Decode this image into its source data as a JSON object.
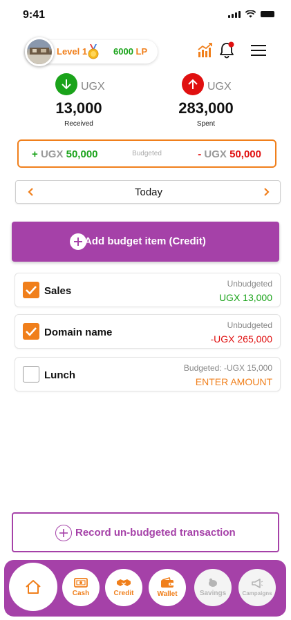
{
  "status_bar": {
    "time": "9:41"
  },
  "header": {
    "level": "Level 1",
    "points_value": "6000",
    "points_unit": "LP",
    "icons": [
      "avatar",
      "medal-icon",
      "chart-icon",
      "bell-icon",
      "menu-icon"
    ]
  },
  "summary": {
    "received": {
      "currency": "UGX",
      "amount": "13,000",
      "label": "Received",
      "color": "#1aa31a"
    },
    "spent": {
      "currency": "UGX",
      "amount": "283,000",
      "label": "Spent",
      "color": "#e01010"
    }
  },
  "budget_bar": {
    "left_sign": "+",
    "left_currency": "UGX",
    "left_amount": "50,000",
    "center_label": "Budgeted",
    "right_sign": "-",
    "right_currency": "UGX",
    "right_amount": "50,000"
  },
  "date_nav": {
    "label": "Today"
  },
  "add_button": {
    "label": "Add budget item (Credit)"
  },
  "items": [
    {
      "name": "Sales",
      "status": "Unbudgeted",
      "amount": "UGX 13,000",
      "checked": true,
      "amount_color": "#1aa31a"
    },
    {
      "name": "Domain name",
      "status": "Unbudgeted",
      "amount": "-UGX 265,000",
      "checked": true,
      "amount_color": "#e01010"
    },
    {
      "name": "Lunch",
      "status": "Budgeted: -UGX 15,000",
      "amount": "ENTER AMOUNT",
      "checked": false,
      "amount_color": "#f07f1b"
    }
  ],
  "record_button": {
    "label": "Record un-budgeted transaction"
  },
  "bottom_nav": {
    "items": [
      {
        "label": "Cash",
        "icon": "cash-icon"
      },
      {
        "label": "Credit",
        "icon": "handshake-icon"
      },
      {
        "label": "Wallet",
        "icon": "wallet-icon"
      },
      {
        "label": "Savings",
        "icon": "piggy-bank-icon"
      },
      {
        "label": "Campaigns",
        "icon": "megaphone-icon"
      }
    ]
  },
  "colors": {
    "accent_purple": "#a541a8",
    "accent_orange": "#f07f1b",
    "positive": "#1aa31a",
    "negative": "#e01010"
  }
}
